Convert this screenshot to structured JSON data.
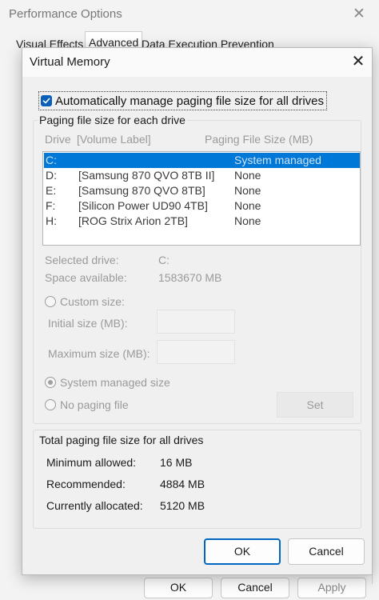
{
  "background_window": {
    "title": "Performance Options",
    "close": "✕",
    "tabs": [
      "Visual Effects",
      "Advanced",
      "Data Execution Prevention"
    ],
    "buttons": {
      "ok": "OK",
      "cancel": "Cancel",
      "apply": "Apply"
    }
  },
  "dialog": {
    "title": "Virtual Memory",
    "close": "✕",
    "auto_manage": {
      "label": "Automatically manage paging file size for all drives",
      "checked": true
    },
    "paging_group": {
      "title": "Paging file size for each drive",
      "headers": {
        "drive": "Drive",
        "volume": "[Volume Label]",
        "size": "Paging File Size (MB)"
      },
      "rows": [
        {
          "drive": "C:",
          "volume": "",
          "size": "System managed"
        },
        {
          "drive": "D:",
          "volume": "[Samsung 870 QVO 8TB II]",
          "size": "None"
        },
        {
          "drive": "E:",
          "volume": "[Samsung 870 QVO 8TB]",
          "size": "None"
        },
        {
          "drive": "F:",
          "volume": "[Silicon Power UD90 4TB]",
          "size": "None"
        },
        {
          "drive": "H:",
          "volume": "[ROG Strix Arion 2TB]",
          "size": "None"
        }
      ],
      "selected_drive_label": "Selected drive:",
      "selected_drive_value": "C:",
      "space_available_label": "Space available:",
      "space_available_value": "1583670 MB",
      "custom_size_label": "Custom size:",
      "initial_size_label": "Initial size (MB):",
      "maximum_size_label": "Maximum size (MB):",
      "system_managed_label": "System managed size",
      "no_paging_label": "No paging file",
      "set_button": "Set"
    },
    "total_group": {
      "title": "Total paging file size for all drives",
      "minimum_label": "Minimum allowed:",
      "minimum_value": "16 MB",
      "recommended_label": "Recommended:",
      "recommended_value": "4884 MB",
      "allocated_label": "Currently allocated:",
      "allocated_value": "5120 MB"
    },
    "buttons": {
      "ok": "OK",
      "cancel": "Cancel"
    }
  },
  "colors": {
    "accent": "#0078d7",
    "focus_border": "#0067c0",
    "disabled_text": "#9a9a9a"
  }
}
